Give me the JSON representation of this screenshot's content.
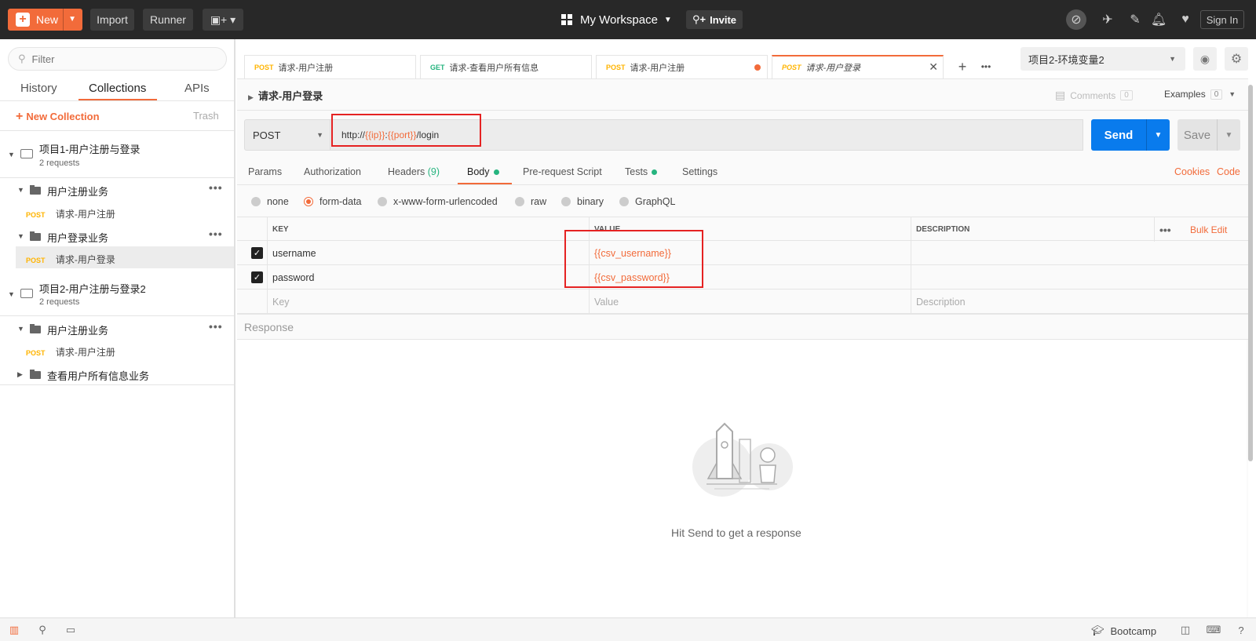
{
  "topbar": {
    "new_label": "New",
    "import_label": "Import",
    "runner_label": "Runner",
    "workspace_label": "My Workspace",
    "invite_label": "Invite",
    "signin_label": "Sign In"
  },
  "sidebar": {
    "filter_placeholder": "Filter",
    "tabs": [
      "History",
      "Collections",
      "APIs"
    ],
    "new_collection": "New Collection",
    "trash": "Trash",
    "collections": [
      {
        "name": "项目1-用户注册与登录",
        "sub": "2 requests",
        "folders": [
          {
            "name": "用户注册业务",
            "requests": [
              {
                "method": "POST",
                "name": "请求-用户注册"
              }
            ]
          },
          {
            "name": "用户登录业务",
            "requests": [
              {
                "method": "POST",
                "name": "请求-用户登录"
              }
            ]
          }
        ]
      },
      {
        "name": "项目2-用户注册与登录2",
        "sub": "2 requests",
        "folders": [
          {
            "name": "用户注册业务",
            "requests": [
              {
                "method": "POST",
                "name": "请求-用户注册"
              }
            ]
          },
          {
            "name": "查看用户所有信息业务",
            "requests": []
          }
        ]
      }
    ]
  },
  "tabs": [
    {
      "method": "POST",
      "name": "请求-用户注册"
    },
    {
      "method": "GET",
      "name": "请求-查看用户所有信息"
    },
    {
      "method": "POST",
      "name": "请求-用户注册"
    },
    {
      "method": "POST",
      "name": "请求-用户登录"
    }
  ],
  "environment": {
    "selected": "项目2-环境变量2"
  },
  "request": {
    "name": "请求-用户登录",
    "comments_label": "Comments",
    "comments_count": "0",
    "examples_label": "Examples",
    "examples_count": "0",
    "method": "POST",
    "url_prefix": "http://",
    "url_var_ip": "{{ip}}",
    "url_colon": ":",
    "url_var_port": "{{port}}",
    "url_suffix": "/login",
    "send_label": "Send",
    "save_label": "Save"
  },
  "request_tabs": {
    "params": "Params",
    "authorization": "Authorization",
    "headers": "Headers",
    "headers_count": "(9)",
    "body": "Body",
    "prerequest": "Pre-request Script",
    "tests": "Tests",
    "settings": "Settings",
    "cookies": "Cookies",
    "code": "Code"
  },
  "body_types": [
    "none",
    "form-data",
    "x-www-form-urlencoded",
    "raw",
    "binary",
    "GraphQL"
  ],
  "form_table": {
    "headers": {
      "key": "KEY",
      "value": "VALUE",
      "description": "DESCRIPTION"
    },
    "bulk_edit": "Bulk Edit",
    "rows": [
      {
        "key": "username",
        "value": "{{csv_username}}",
        "description": ""
      },
      {
        "key": "password",
        "value": "{{csv_password}}",
        "description": ""
      }
    ],
    "placeholder": {
      "key": "Key",
      "value": "Value",
      "description": "Description"
    }
  },
  "response": {
    "label": "Response",
    "hint": "Hit Send to get a response"
  },
  "bottombar": {
    "bootcamp": "Bootcamp"
  },
  "colors": {
    "accent": "#f26b3a",
    "send": "#097bed",
    "post": "#ffb400",
    "get": "#26b47f",
    "annotation": "#e52222"
  }
}
